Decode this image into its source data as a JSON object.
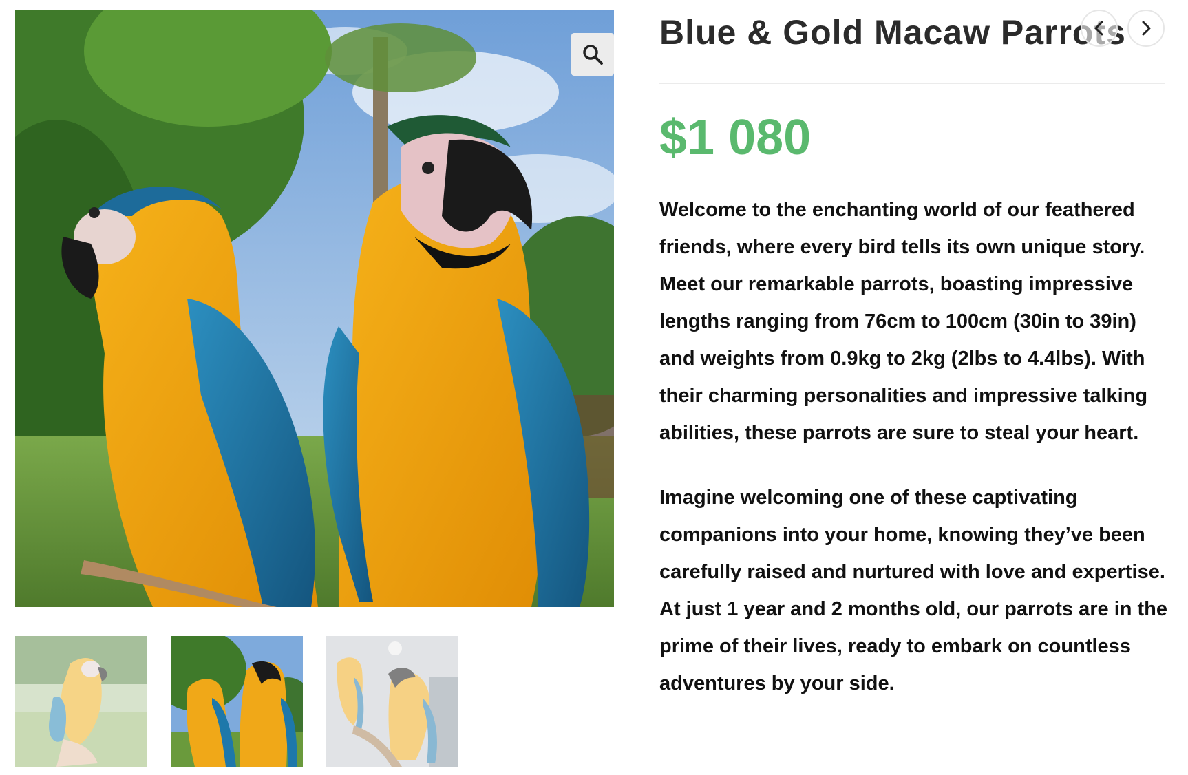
{
  "product": {
    "title": "Blue & Gold Macaw Parrots",
    "price": "$1 080",
    "description": [
      "Welcome to the enchanting world of our feathered friends, where every bird tells its own unique story. Meet our remarkable parrots, boasting impressive lengths ranging from 76cm to 100cm (30in to 39in) and weights from 0.9kg to 2kg (2lbs to 4.4lbs). With their charming personalities and impressive talking abilities, these parrots are sure to steal your heart.",
      "Imagine welcoming one of these captivating companions into your home, knowing they’ve been carefully raised and nurtured with love and expertise. At just 1 year and 2 months old, our parrots are in the prime of their lives, ready to embark on countless adventures by your side."
    ]
  },
  "gallery": {
    "zoom_icon": "search-icon",
    "thumbnails": [
      {
        "name": "thumbnail-macaw-on-hand",
        "active": false
      },
      {
        "name": "thumbnail-two-macaws",
        "active": true
      },
      {
        "name": "thumbnail-macaws-indoors",
        "active": false
      }
    ]
  },
  "navigation": {
    "prev_icon": "chevron-left-icon",
    "next_icon": "chevron-right-icon"
  },
  "colors": {
    "price": "#5ab96e",
    "title": "#2b2b2b",
    "text": "#111111"
  }
}
